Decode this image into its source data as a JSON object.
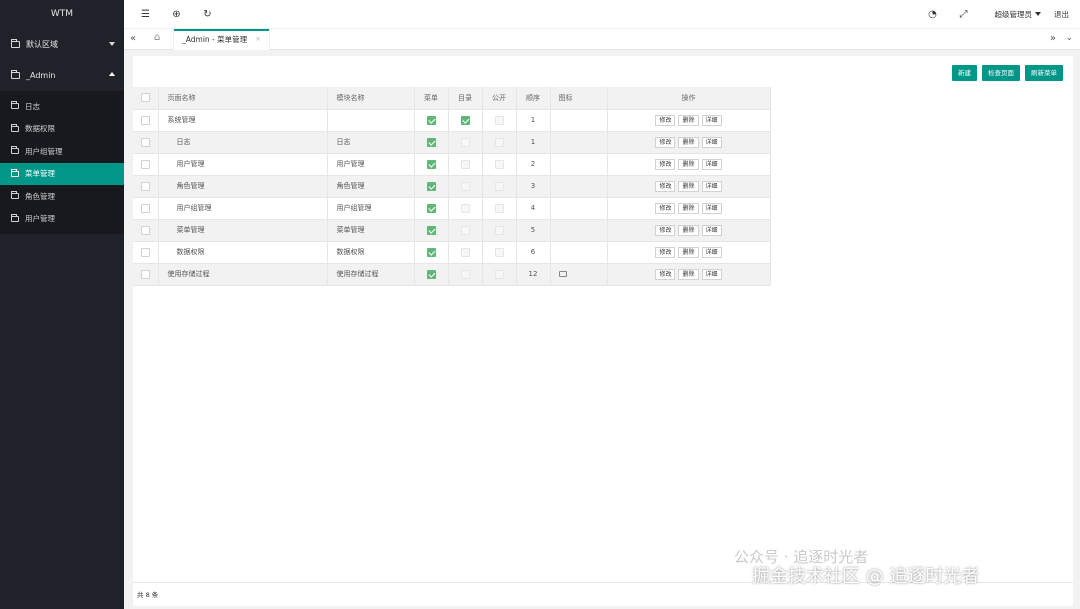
{
  "sidebar": {
    "brand": "WTM",
    "groups": [
      {
        "label": "默认区域",
        "expanded": false
      },
      {
        "label": "_Admin",
        "expanded": true
      }
    ],
    "items": [
      {
        "label": "日志"
      },
      {
        "label": "数据权限"
      },
      {
        "label": "用户组管理"
      },
      {
        "label": "菜单管理",
        "active": true
      },
      {
        "label": "角色管理"
      },
      {
        "label": "用户管理"
      }
    ]
  },
  "header": {
    "user": "超级管理员",
    "logout": "退出"
  },
  "tabs": [
    {
      "label": "_Admin - 菜单管理",
      "close": "×",
      "active": true
    }
  ],
  "toolbar": {
    "new": "新建",
    "check_pages": "检查页面",
    "refresh_menu": "刷新菜单"
  },
  "table": {
    "columns": [
      "页面名称",
      "模块名称",
      "菜单",
      "目录",
      "公开",
      "顺序",
      "图标",
      "操作"
    ],
    "rows": [
      {
        "name": "系统管理",
        "module": "",
        "menu": true,
        "dir": true,
        "public": false,
        "order": "1",
        "icon": "",
        "child": false
      },
      {
        "name": "日志",
        "module": "日志",
        "menu": true,
        "dir": false,
        "public": false,
        "order": "1",
        "icon": "",
        "child": true
      },
      {
        "name": "用户管理",
        "module": "用户管理",
        "menu": true,
        "dir": false,
        "public": false,
        "order": "2",
        "icon": "",
        "child": true
      },
      {
        "name": "角色管理",
        "module": "角色管理",
        "menu": true,
        "dir": false,
        "public": false,
        "order": "3",
        "icon": "",
        "child": true
      },
      {
        "name": "用户组管理",
        "module": "用户组管理",
        "menu": true,
        "dir": false,
        "public": false,
        "order": "4",
        "icon": "",
        "child": true
      },
      {
        "name": "菜单管理",
        "module": "菜单管理",
        "menu": true,
        "dir": false,
        "public": false,
        "order": "5",
        "icon": "",
        "child": true
      },
      {
        "name": "数据权限",
        "module": "数据权限",
        "menu": true,
        "dir": false,
        "public": false,
        "order": "6",
        "icon": "",
        "child": true
      },
      {
        "name": "使用存储过程",
        "module": "使用存储过程",
        "menu": true,
        "dir": false,
        "public": false,
        "order": "12",
        "icon": "password-icon",
        "child": false
      }
    ],
    "ops": {
      "edit": "修改",
      "delete": "删除",
      "detail": "详细"
    }
  },
  "footer": {
    "total": "共 8 条"
  },
  "watermark": {
    "line1": "公众号 · 追逐时光者",
    "line2": "掘金技术社区 @ 追逐时光者"
  },
  "colors": {
    "accent": "#009688",
    "sidebar_bg": "#20222a",
    "check_green": "#5FB878"
  }
}
